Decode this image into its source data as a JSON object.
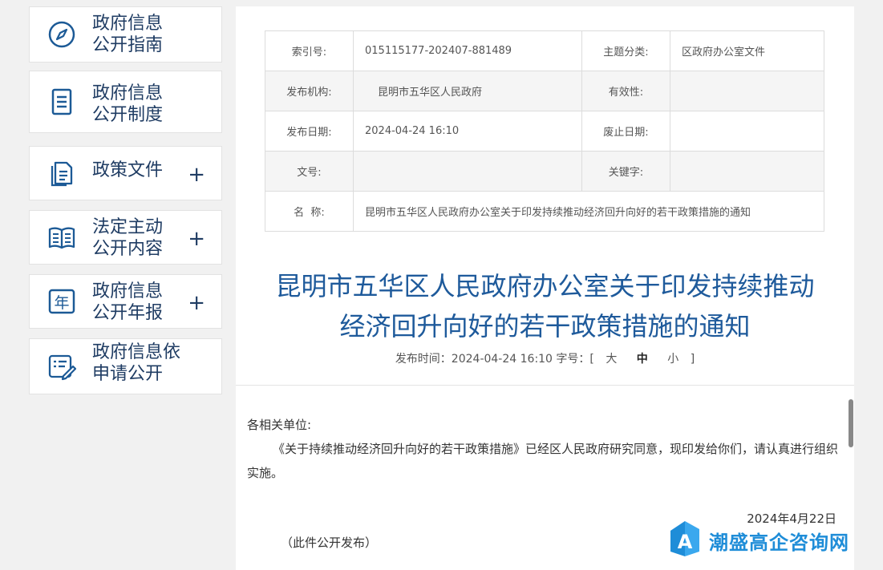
{
  "sidebar": {
    "items": [
      {
        "label": "政府信息\n公开指南",
        "icon": "compass-icon",
        "expandable": false
      },
      {
        "label": "政府信息\n公开制度",
        "icon": "document-icon",
        "expandable": false
      },
      {
        "label": "政策文件",
        "icon": "files-icon",
        "expandable": true
      },
      {
        "label": "法定主动\n公开内容",
        "icon": "book-icon",
        "expandable": true
      },
      {
        "label": "政府信息\n公开年报",
        "icon": "year-icon",
        "expandable": true
      },
      {
        "label": "政府信息依\n申请公开",
        "icon": "form-edit-icon",
        "expandable": false
      }
    ],
    "plus_symbol": "+",
    "year_char": "年",
    "accent_color": "#1c5a96"
  },
  "meta": {
    "index_label": "索引号:",
    "index_value": "015115177-202407-881489",
    "category_label": "主题分类:",
    "category_value": "区政府办公室文件",
    "publisher_label": "发布机构:",
    "publisher_value": "昆明市五华区人民政府",
    "validity_label": "有效性:",
    "validity_value": "",
    "pubdate_label": "发布日期:",
    "pubdate_value": "2024-04-24 16:10",
    "expiry_label": "废止日期:",
    "expiry_value": "",
    "docno_label": "文号:",
    "docno_value": "",
    "keywords_label": "关键字:",
    "keywords_value": "",
    "name_label": "名  称:",
    "name_value": "昆明市五华区人民政府办公室关于印发持续推动经济回升向好的若干政策措施的通知"
  },
  "article": {
    "title_line1": "昆明市五华区人民政府办公室关于印发持续推动",
    "title_line2": "经济回升向好的若干政策措施的通知",
    "pubinfo_prefix": "发布时间：2024-04-24 16:10 字号：[",
    "size_large": "大",
    "size_medium": "中",
    "size_small": "小",
    "pubinfo_suffix": "]",
    "salutation": "各相关单位:",
    "paragraph": "《关于持续推动经济回升向好的若干政策措施》已经区人民政府研究同意，现印发给你们，请认真进行组织实施。",
    "date": "2024年4月22日",
    "note": "（此件公开发布）",
    "title_color": "#1e5a9b"
  },
  "watermark": {
    "text": "潮盛高企咨询网",
    "logo_letter": "A",
    "color": "#1f8dd8"
  }
}
